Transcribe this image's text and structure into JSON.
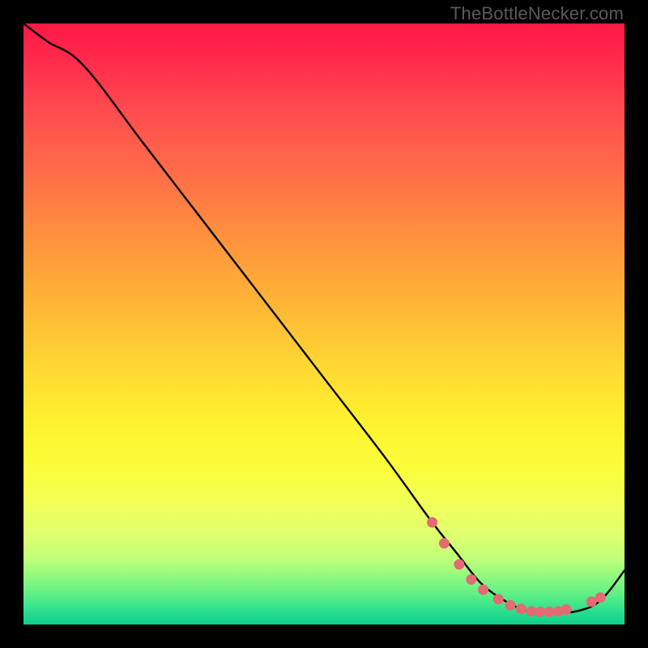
{
  "watermark": "TheBottleNecker.com",
  "chart_data": {
    "type": "line",
    "title": "",
    "xlabel": "",
    "ylabel": "",
    "xlim": [
      0,
      100
    ],
    "ylim": [
      0,
      100
    ],
    "series": [
      {
        "name": "bottleneck-curve",
        "x": [
          0,
          4,
          10,
          20,
          30,
          40,
          50,
          60,
          68,
          72,
          76,
          80,
          84,
          88,
          92,
          96,
          100
        ],
        "y": [
          100,
          97,
          93,
          80,
          67,
          54,
          41,
          28,
          17,
          12,
          7,
          4,
          2.2,
          2,
          2.2,
          4,
          9
        ]
      }
    ],
    "markers": {
      "name": "highlight-dots",
      "color": "#e46a74",
      "points": [
        {
          "x": 68,
          "y": 17
        },
        {
          "x": 70,
          "y": 13.5
        },
        {
          "x": 72.5,
          "y": 10
        },
        {
          "x": 74.5,
          "y": 7.5
        },
        {
          "x": 76.5,
          "y": 5.8
        },
        {
          "x": 79,
          "y": 4.2
        },
        {
          "x": 81,
          "y": 3.2
        },
        {
          "x": 82.8,
          "y": 2.6
        },
        {
          "x": 84.5,
          "y": 2.2
        },
        {
          "x": 86,
          "y": 2.1
        },
        {
          "x": 87.5,
          "y": 2.1
        },
        {
          "x": 89,
          "y": 2.2
        },
        {
          "x": 90.3,
          "y": 2.5
        },
        {
          "x": 94.5,
          "y": 3.8
        },
        {
          "x": 96,
          "y": 4.5
        }
      ]
    },
    "background_gradient": {
      "top": "#ff1846",
      "mid": "#fff12f",
      "bottom": "#0fcf8c"
    }
  }
}
